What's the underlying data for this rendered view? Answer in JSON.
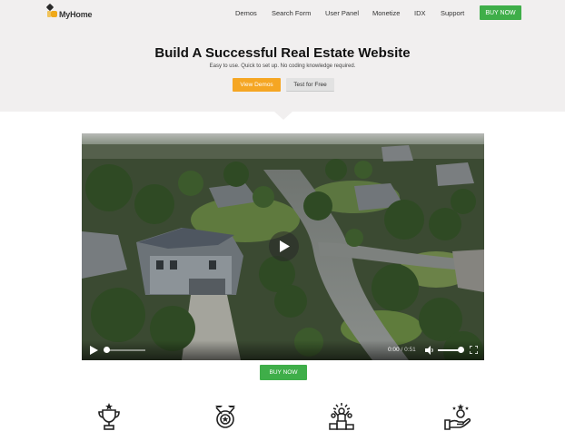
{
  "header": {
    "logo_text": "MyHome",
    "nav": {
      "demos": "Demos",
      "search_form": "Search Form",
      "user_panel": "User Panel",
      "monetize": "Monetize",
      "idx": "IDX",
      "support": "Support"
    },
    "buy_now": "BUY NOW"
  },
  "hero": {
    "title": "Build A Successful Real Estate Website",
    "subtitle": "Easy to use. Quick to set up. No coding knowledge required.",
    "view_demos": "View Demos",
    "test_free": "Test for Free"
  },
  "video": {
    "current_time": "0:00",
    "separator": " / ",
    "duration": "0:51",
    "progress": 0,
    "volume": 1
  },
  "cta": {
    "buy_now": "BUY NOW"
  },
  "features": {
    "icons": [
      "trophy-icon",
      "medal-icon",
      "winner-podium-icon",
      "hand-star-icon"
    ]
  },
  "colors": {
    "accent_green": "#3fae49",
    "accent_orange": "#f5a623",
    "hero_bg": "#f1efef"
  }
}
